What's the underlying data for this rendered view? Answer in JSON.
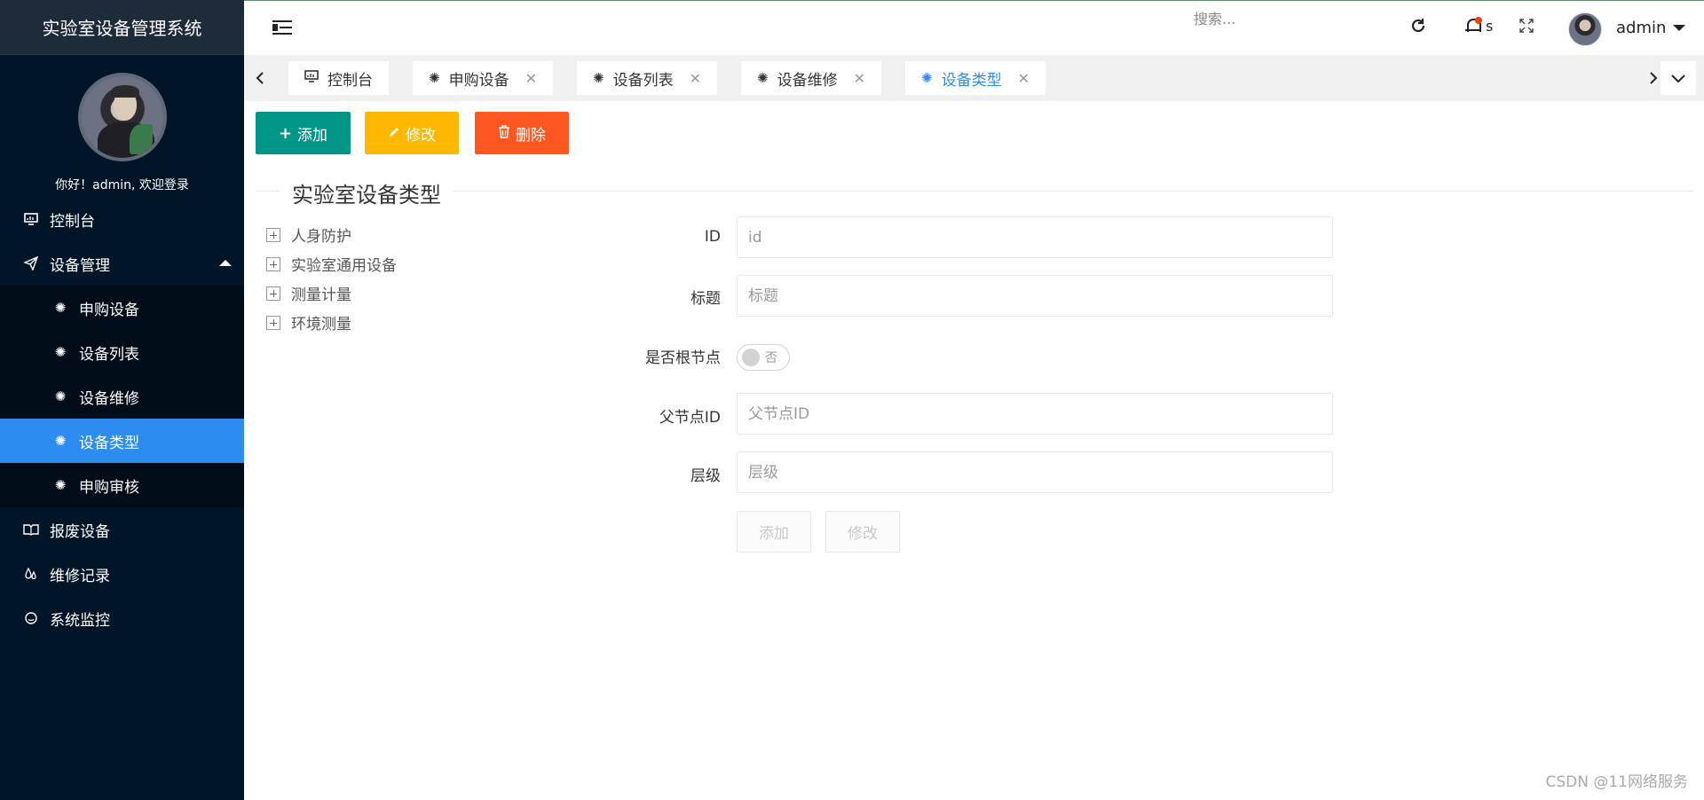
{
  "app": {
    "title": "实验室设备管理系统"
  },
  "user": {
    "greeting": "你好！admin, 欢迎登录",
    "name": "admin",
    "notification_count": "s"
  },
  "sidebar": {
    "items": [
      {
        "label": "控制台",
        "icon": "monitor-icon"
      },
      {
        "label": "设备管理",
        "icon": "send-icon",
        "expanded": true,
        "children": [
          {
            "label": "申购设备",
            "icon": "palm-icon"
          },
          {
            "label": "设备列表",
            "icon": "palm-icon"
          },
          {
            "label": "设备维修",
            "icon": "palm-icon"
          },
          {
            "label": "设备类型",
            "icon": "palm-icon",
            "active": true
          },
          {
            "label": "申购审核",
            "icon": "palm-icon"
          }
        ]
      },
      {
        "label": "报废设备",
        "icon": "book-icon"
      },
      {
        "label": "维修记录",
        "icon": "drops-icon"
      },
      {
        "label": "系统监控",
        "icon": "circle-icon"
      }
    ]
  },
  "header": {
    "search_placeholder": "搜索..."
  },
  "tabs": [
    {
      "label": "控制台",
      "closable": false
    },
    {
      "label": "申购设备",
      "closable": true
    },
    {
      "label": "设备列表",
      "closable": true
    },
    {
      "label": "设备维修",
      "closable": true
    },
    {
      "label": "设备类型",
      "closable": true,
      "active": true
    }
  ],
  "toolbar": {
    "add_label": "添加",
    "edit_label": "修改",
    "delete_label": "删除"
  },
  "section": {
    "title": "实验室设备类型"
  },
  "tree": [
    "人身防护",
    "实验室通用设备",
    "测量计量",
    "环境测量"
  ],
  "form": {
    "id_label": "ID",
    "id_placeholder": "id",
    "title_label": "标题",
    "title_placeholder": "标题",
    "root_label": "是否根节点",
    "root_switch_text": "否",
    "parent_label": "父节点ID",
    "parent_placeholder": "父节点ID",
    "level_label": "层级",
    "level_placeholder": "层级",
    "add_button": "添加",
    "edit_button": "修改"
  },
  "watermark": "CSDN @11网络服务",
  "colors": {
    "sidebar_bg": "#011529",
    "active": "#2d8cf0",
    "add": "#009688",
    "edit": "#ffb800",
    "delete": "#ff5722"
  }
}
